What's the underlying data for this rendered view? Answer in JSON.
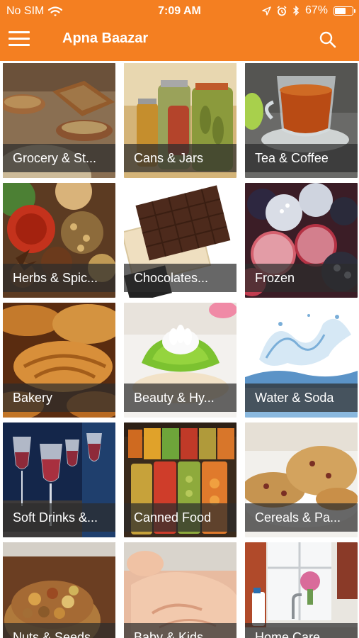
{
  "status_bar": {
    "carrier": "No SIM",
    "time": "7:09 AM",
    "battery_percent": "67%",
    "battery_level": 0.67,
    "icons": [
      "wifi-icon",
      "location-arrow-icon",
      "alarm-clock-icon",
      "bluetooth-icon",
      "battery-icon"
    ]
  },
  "header": {
    "title": "Apna Baazar",
    "menu_icon": "hamburger-menu-icon",
    "search_icon": "search-icon",
    "color": "#f47f21"
  },
  "categories": [
    {
      "label": "Grocery & St...",
      "image": "grocery-image"
    },
    {
      "label": "Cans & Jars",
      "image": "cans-jars-image"
    },
    {
      "label": "Tea & Coffee",
      "image": "tea-coffee-image"
    },
    {
      "label": "Herbs & Spic...",
      "image": "herbs-spices-image"
    },
    {
      "label": "Chocolates...",
      "image": "chocolates-image"
    },
    {
      "label": "Frozen",
      "image": "frozen-image"
    },
    {
      "label": "Bakery",
      "image": "bakery-image"
    },
    {
      "label": "Beauty & Hy...",
      "image": "beauty-hygiene-image"
    },
    {
      "label": "Water & Soda",
      "image": "water-soda-image"
    },
    {
      "label": "Soft Drinks &...",
      "image": "soft-drinks-image"
    },
    {
      "label": "Canned Food",
      "image": "canned-food-image"
    },
    {
      "label": "Cereals & Pa...",
      "image": "cereals-image"
    },
    {
      "label": "Nuts & Seeds",
      "image": "nuts-seeds-image"
    },
    {
      "label": "Baby & Kids",
      "image": "baby-kids-image"
    },
    {
      "label": "Home Care",
      "image": "home-care-image"
    }
  ]
}
